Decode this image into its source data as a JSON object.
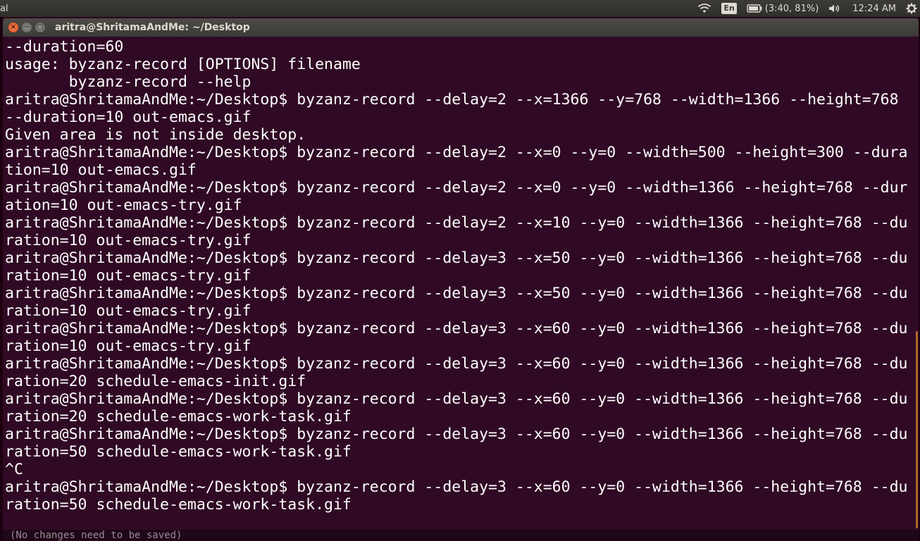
{
  "topbar": {
    "app_name": "al",
    "keyboard_layout": "En",
    "battery": "(3:40, 81%)",
    "clock": "12:24 AM",
    "icons": [
      "wifi-icon",
      "keyboard-layout-indicator",
      "battery-icon",
      "volume-icon",
      "gear-icon"
    ]
  },
  "window": {
    "title": "aritra@ShritamaAndMe: ~/Desktop",
    "close_glyph": "×",
    "minimize_glyph": "−",
    "maximize_glyph": "□"
  },
  "terminal": {
    "lines": [
      "--duration=60",
      "usage: byzanz-record [OPTIONS] filename",
      "       byzanz-record --help",
      "aritra@ShritamaAndMe:~/Desktop$ byzanz-record --delay=2 --x=1366 --y=768 --width=1366 --height=768",
      "--duration=10 out-emacs.gif",
      "Given area is not inside desktop.",
      "aritra@ShritamaAndMe:~/Desktop$ byzanz-record --delay=2 --x=0 --y=0 --width=500 --height=300 --dura",
      "tion=10 out-emacs.gif",
      "aritra@ShritamaAndMe:~/Desktop$ byzanz-record --delay=2 --x=0 --y=0 --width=1366 --height=768 --dur",
      "ation=10 out-emacs-try.gif",
      "aritra@ShritamaAndMe:~/Desktop$ byzanz-record --delay=2 --x=10 --y=0 --width=1366 --height=768 --du",
      "ration=10 out-emacs-try.gif",
      "aritra@ShritamaAndMe:~/Desktop$ byzanz-record --delay=3 --x=50 --y=0 --width=1366 --height=768 --du",
      "ration=10 out-emacs-try.gif",
      "aritra@ShritamaAndMe:~/Desktop$ byzanz-record --delay=3 --x=50 --y=0 --width=1366 --height=768 --du",
      "ration=10 out-emacs-try.gif",
      "aritra@ShritamaAndMe:~/Desktop$ byzanz-record --delay=3 --x=60 --y=0 --width=1366 --height=768 --du",
      "ration=10 out-emacs-try.gif",
      "aritra@ShritamaAndMe:~/Desktop$ byzanz-record --delay=3 --x=60 --y=0 --width=1366 --height=768 --du",
      "ration=20 schedule-emacs-init.gif",
      "aritra@ShritamaAndMe:~/Desktop$ byzanz-record --delay=3 --x=60 --y=0 --width=1366 --height=768 --du",
      "ration=20 schedule-emacs-work-task.gif",
      "aritra@ShritamaAndMe:~/Desktop$ byzanz-record --delay=3 --x=60 --y=0 --width=1366 --height=768 --du",
      "ration=50 schedule-emacs-work-task.gif",
      "^C",
      "aritra@ShritamaAndMe:~/Desktop$ byzanz-record --delay=3 --x=60 --y=0 --width=1366 --height=768 --du",
      "ration=50 schedule-emacs-work-task.gif"
    ]
  },
  "statusline": "(No changes need to be saved)",
  "colors": {
    "terminal_bg": "#300a24",
    "text": "#ffffff",
    "panel_bg": "#3c3b37",
    "close_button": "#df4a16"
  }
}
